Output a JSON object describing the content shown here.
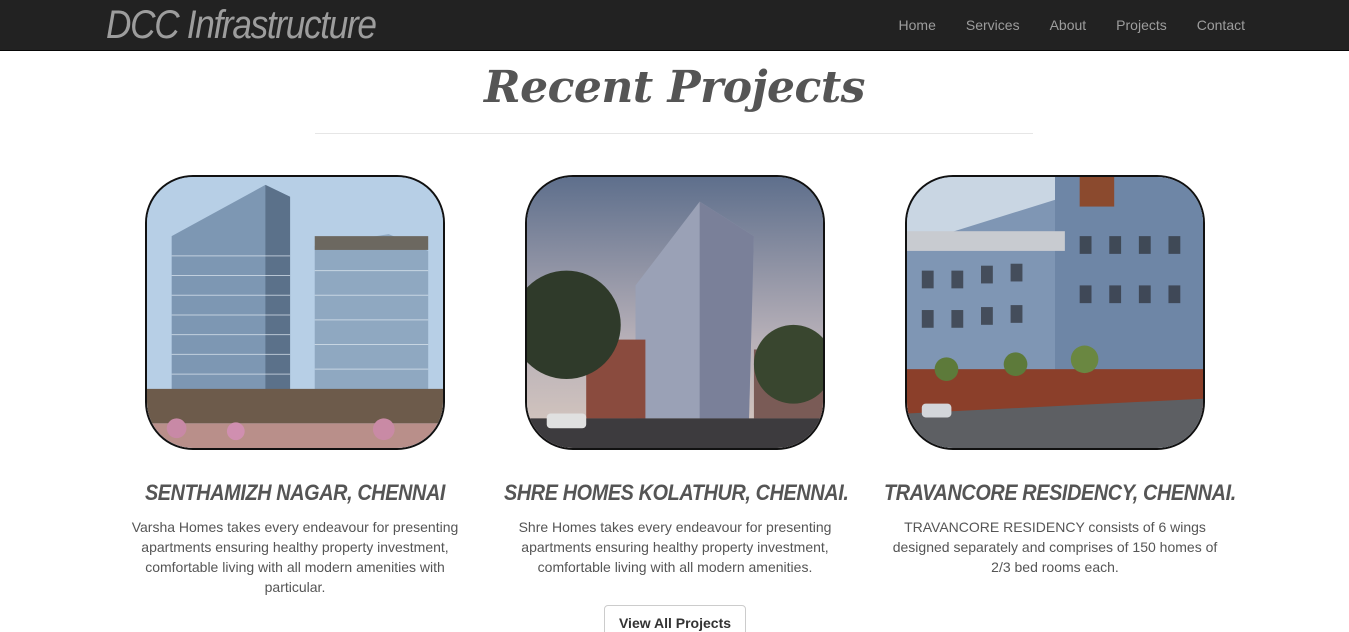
{
  "navbar": {
    "brand": "DCC Infrastructure",
    "links": [
      "Home",
      "Services",
      "About",
      "Projects",
      "Contact"
    ]
  },
  "section": {
    "title": "Recent Projects"
  },
  "projects": [
    {
      "title": "SENTHAMIZH NAGAR, CHENNAI",
      "description": "Varsha Homes takes every endeavour for presenting apartments ensuring healthy property investment, comfortable living with all modern amenities with particular."
    },
    {
      "title": "SHRE HOMES KOLATHUR, CHENNAI.",
      "description": "Shre Homes takes every endeavour for presenting apartments ensuring healthy property investment, comfortable living with all modern amenities."
    },
    {
      "title": "TRAVANCORE RESIDENCY, CHENNAI.",
      "description": "TRAVANCORE RESIDENCY consists of 6 wings designed separately and comprises of 150 homes of 2/3 bed rooms each."
    }
  ],
  "cta": {
    "label": "View All Projects"
  },
  "colors": {
    "navbar_bg": "#222222",
    "nav_text": "#9d9d9d",
    "heading_text": "#555555"
  }
}
